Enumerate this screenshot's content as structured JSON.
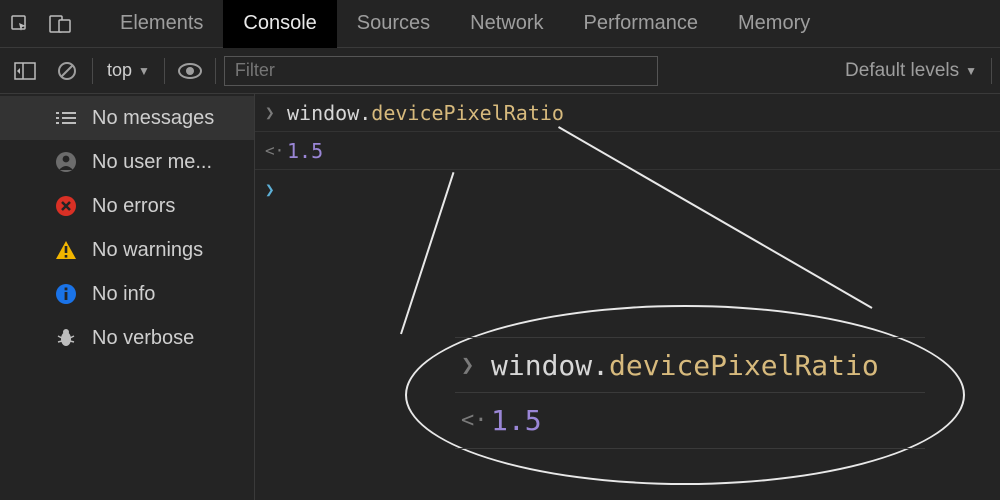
{
  "tabs": {
    "items": [
      {
        "label": "Elements"
      },
      {
        "label": "Console",
        "active": true
      },
      {
        "label": "Sources"
      },
      {
        "label": "Network"
      },
      {
        "label": "Performance"
      },
      {
        "label": "Memory"
      }
    ]
  },
  "toolbar": {
    "context": "top",
    "filter_placeholder": "Filter",
    "levels": "Default levels"
  },
  "sidebar": {
    "items": [
      {
        "label": "No messages",
        "icon": "list",
        "selected": true
      },
      {
        "label": "No user me...",
        "icon": "user"
      },
      {
        "label": "No errors",
        "icon": "error"
      },
      {
        "label": "No warnings",
        "icon": "warning"
      },
      {
        "label": "No info",
        "icon": "info"
      },
      {
        "label": "No verbose",
        "icon": "bug"
      }
    ]
  },
  "console": {
    "input_obj": "window",
    "input_prop": "devicePixelRatio",
    "output": "1.5"
  },
  "callout": {
    "input_obj": "window",
    "input_prop": "devicePixelRatio",
    "output": "1.5"
  }
}
